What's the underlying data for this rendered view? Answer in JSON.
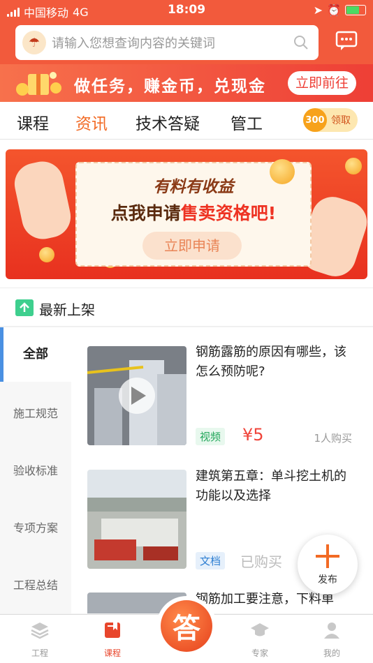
{
  "status": {
    "carrier": "中国移动",
    "network": "4G",
    "time": "18:09"
  },
  "search": {
    "placeholder": "请输入您想查询内容的关键词"
  },
  "promo": {
    "text": "做任务，赚金币，兑现金",
    "button": "立即前往"
  },
  "tabs": [
    {
      "label": "课程",
      "active": false
    },
    {
      "label": "资讯",
      "active": true
    },
    {
      "label": "技术答疑",
      "active": false
    },
    {
      "label": "管工",
      "active": false
    }
  ],
  "coins": {
    "count": "300",
    "label": "领取"
  },
  "banner": {
    "line1": "有料有收益",
    "line2_prefix": "点我申请",
    "line2_highlight": "售卖资格吧!",
    "button": "立即申请"
  },
  "section": {
    "title": "最新上架"
  },
  "sidebar": {
    "items": [
      {
        "label": "全部",
        "active": true
      },
      {
        "label": "施工规范"
      },
      {
        "label": "验收标准"
      },
      {
        "label": "专项方案"
      },
      {
        "label": "工程总结"
      }
    ]
  },
  "list": [
    {
      "title": "钢筋露筋的原因有哪些，该怎么预防呢?",
      "tag": "视频",
      "price": "¥5",
      "buyers": "1人购买"
    },
    {
      "title": "建筑第五章：单斗挖土机的功能以及选择",
      "tag": "文档",
      "status": "已购买"
    },
    {
      "title": "钢筋加工要注意，下料单"
    }
  ],
  "publish": {
    "label": "发布"
  },
  "bottom_nav": {
    "items": [
      {
        "label": "工程"
      },
      {
        "label": "课程",
        "active": true
      },
      {
        "label": "答"
      },
      {
        "label": "专家"
      },
      {
        "label": "我的"
      }
    ]
  },
  "colors": {
    "brand": "#f25a3c",
    "accent": "#f26a24",
    "price": "#f0443a"
  }
}
